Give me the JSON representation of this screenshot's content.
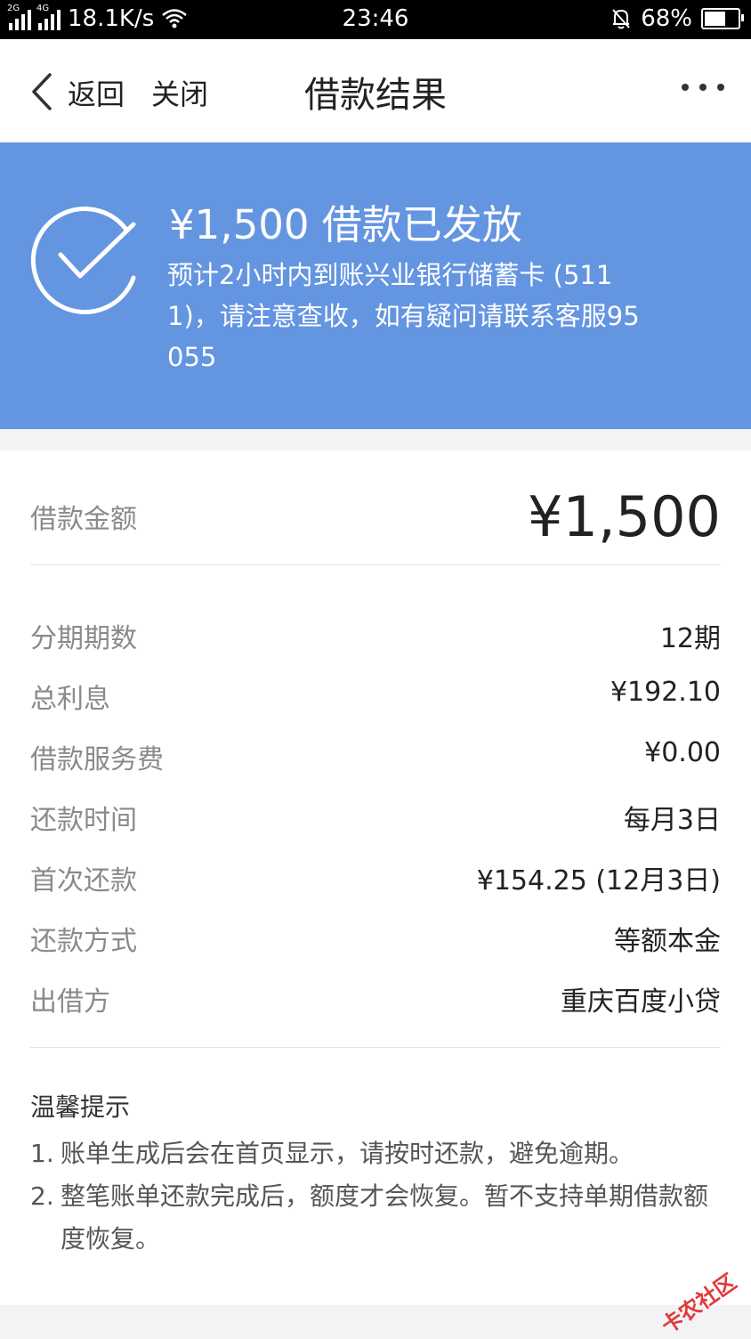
{
  "status_bar": {
    "net1": "2G",
    "net2": "4G",
    "speed": "18.1K/s",
    "time": "23:46",
    "battery_text": "68%",
    "battery_level": 0.68
  },
  "nav": {
    "back_label": "返回",
    "close_label": "关闭",
    "title": "借款结果"
  },
  "banner": {
    "title": "¥1,500 借款已发放",
    "description": "预计2小时内到账兴业银行储蓄卡 (5111)，请注意查收，如有疑问请联系客服95055",
    "bg_color": "#6495e1"
  },
  "details": {
    "amount_label": "借款金额",
    "amount_value": "¥1,500",
    "rows": [
      {
        "label": "分期期数",
        "value": "12期"
      },
      {
        "label": "总利息",
        "value": "¥192.10"
      },
      {
        "label": "借款服务费",
        "value": "¥0.00"
      },
      {
        "label": "还款时间",
        "value": "每月3日"
      },
      {
        "label": "首次还款",
        "value": "¥154.25 (12月3日)"
      },
      {
        "label": "还款方式",
        "value": "等额本金"
      },
      {
        "label": "出借方",
        "value": "重庆百度小贷"
      }
    ]
  },
  "tips": {
    "title": "温馨提示",
    "items": [
      {
        "num": "1.",
        "text": "账单生成后会在首页显示，请按时还款，避免逾期。"
      },
      {
        "num": "2.",
        "text": "整笔账单还款完成后，额度才会恢复。暂不支持单期借款额度恢复。"
      }
    ]
  },
  "watermark": "卡农社区"
}
